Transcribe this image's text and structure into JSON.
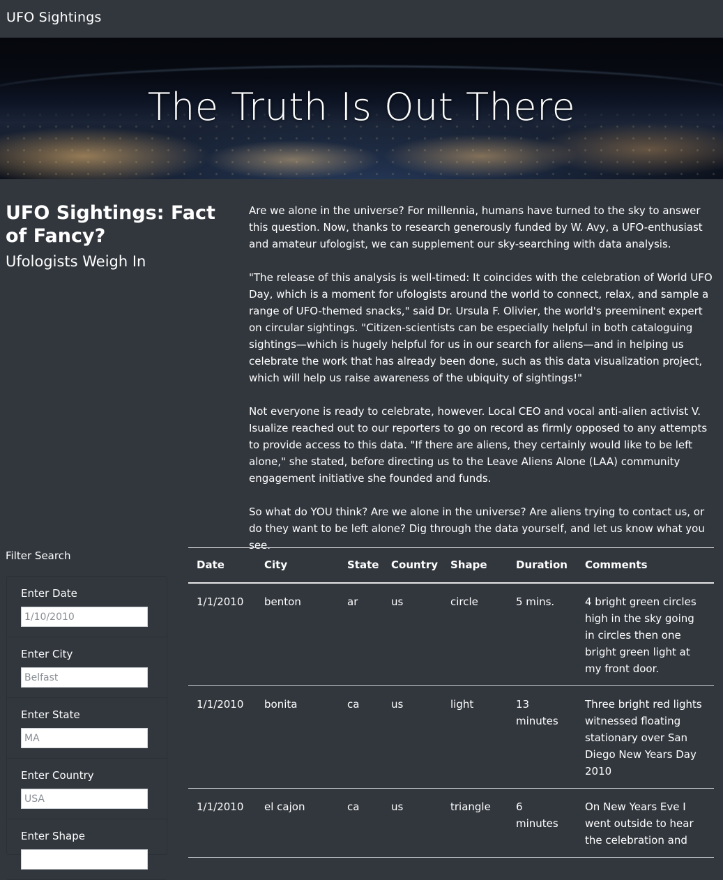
{
  "navbar": {
    "brand": "UFO Sightings"
  },
  "hero": {
    "title": "The Truth Is Out There"
  },
  "article": {
    "title": "UFO Sightings: Fact of Fancy?",
    "subtitle": "Ufologists Weigh In",
    "paragraphs": [
      "Are we alone in the universe? For millennia, humans have turned to the sky to answer this question. Now, thanks to research generously funded by W. Avy, a UFO-enthusiast and amateur ufologist, we can supplement our sky-searching with data analysis.",
      "\"The release of this analysis is well-timed: It coincides with the celebration of World UFO Day, which is a moment for ufologists around the world to connect, relax, and sample a range of UFO-themed snacks,\" said Dr. Ursula F. Olivier, the world's preeminent expert on circular sightings. \"Citizen-scientists can be especially helpful in both cataloguing sightings—which is hugely helpful for us in our search for aliens—and in helping us celebrate the work that has already been done, such as this data visualization project, which will help us raise awareness of the ubiquity of sightings!\"",
      "Not everyone is ready to celebrate, however. Local CEO and vocal anti-alien activist V. Isualize reached out to our reporters to go on record as firmly opposed to any attempts to provide access to this data. \"If there are aliens, they certainly would like to be left alone,\" she stated, before directing us to the Leave Aliens Alone (LAA) community engagement initiative she founded and funds.",
      "So what do YOU think? Are we alone in the universe? Are aliens trying to contact us, or do they want to be left alone? Dig through the data yourself, and let us know what you see."
    ]
  },
  "filters": {
    "title": "Filter Search",
    "items": [
      {
        "label": "Enter Date",
        "placeholder": "1/10/2010"
      },
      {
        "label": "Enter City",
        "placeholder": "Belfast"
      },
      {
        "label": "Enter State",
        "placeholder": "MA"
      },
      {
        "label": "Enter Country",
        "placeholder": "USA"
      },
      {
        "label": "Enter Shape",
        "placeholder": ""
      }
    ]
  },
  "table": {
    "headers": [
      "Date",
      "City",
      "State",
      "Country",
      "Shape",
      "Duration",
      "Comments"
    ],
    "rows": [
      [
        "1/1/2010",
        "benton",
        "ar",
        "us",
        "circle",
        "5 mins.",
        "4 bright green circles high in the sky going in circles then one bright green light at my front door."
      ],
      [
        "1/1/2010",
        "bonita",
        "ca",
        "us",
        "light",
        "13 minutes",
        "Three bright red lights witnessed floating stationary over San Diego New Years Day 2010"
      ],
      [
        "1/1/2010",
        "el cajon",
        "ca",
        "us",
        "triangle",
        "6 minutes",
        "On New Years Eve I went outside to hear the celebration and"
      ]
    ]
  }
}
